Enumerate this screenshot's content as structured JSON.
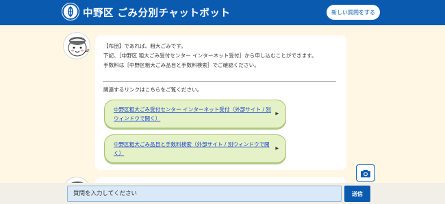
{
  "header": {
    "title": "中野区 ごみ分別チャットボット",
    "new_question_label": "新しい質問をする"
  },
  "message": {
    "lines": [
      "【布団】であれば、粗大ごみです。",
      "下記、［中野区 粗大ごみ受付センター インターネット受付］から申し込むことができます。",
      "手数料は［中野区粗大ごみ品目と手数料検索］でご確認ください。"
    ],
    "related_heading": "関連するリンクはこちらをご覧ください。",
    "links": [
      {
        "label": "中野区粗大ごみ受付センター インターネット受付（外部サイト / 別ウィンドウで開く）"
      },
      {
        "label": "中野区粗大ごみ品目と手数料検索（外部サイト / 別ウィンドウで開く）"
      }
    ]
  },
  "icons": {
    "camera": "camera-icon",
    "arrow": "triangle-right-icon"
  },
  "input": {
    "placeholder": "質問を入力してください",
    "send_label": "送信"
  },
  "colors": {
    "brand": "#0a5bb0",
    "background": "#fff7e3",
    "link_button": "#e5f1c6",
    "link_text": "#1a44d0"
  }
}
